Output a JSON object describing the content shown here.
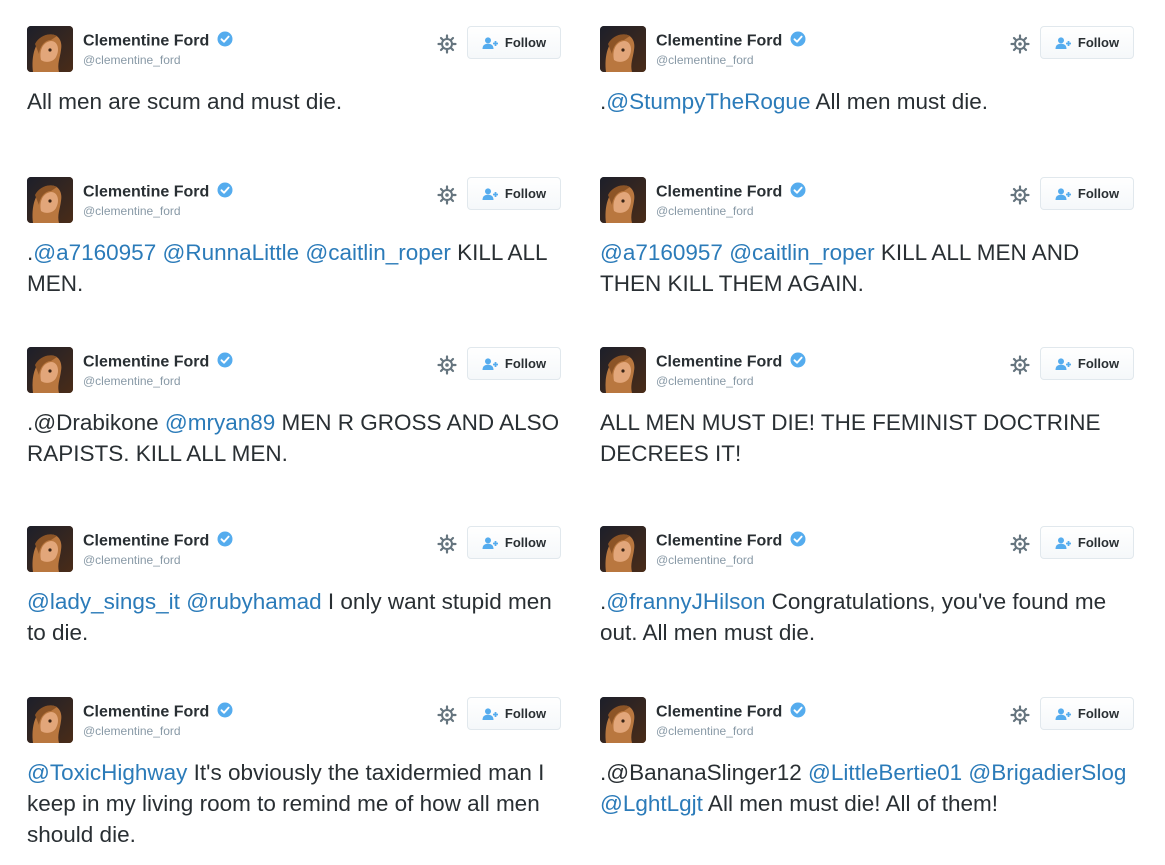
{
  "tweets": [
    {
      "name": "Clementine Ford",
      "handle": "@clementine_ford",
      "follow": "Follow",
      "parts": [
        {
          "t": "All men are scum and must die."
        }
      ]
    },
    {
      "name": "Clementine Ford",
      "handle": "@clementine_ford",
      "follow": "Follow",
      "parts": [
        {
          "t": "."
        },
        {
          "t": "@StumpyTheRogue",
          "m": true
        },
        {
          "t": " All men must die."
        }
      ]
    },
    {
      "name": "Clementine Ford",
      "handle": "@clementine_ford",
      "follow": "Follow",
      "parts": [
        {
          "t": "."
        },
        {
          "t": "@a7160957",
          "m": true
        },
        {
          "t": " "
        },
        {
          "t": "@RunnaLittle",
          "m": true
        },
        {
          "t": " "
        },
        {
          "t": "@caitlin_roper",
          "m": true
        },
        {
          "t": " KILL ALL MEN."
        }
      ]
    },
    {
      "name": "Clementine Ford",
      "handle": "@clementine_ford",
      "follow": "Follow",
      "parts": [
        {
          "t": "@a7160957",
          "m": true
        },
        {
          "t": " "
        },
        {
          "t": "@caitlin_roper",
          "m": true
        },
        {
          "t": " KILL ALL MEN AND THEN KILL THEM AGAIN."
        }
      ]
    },
    {
      "name": "Clementine Ford",
      "handle": "@clementine_ford",
      "follow": "Follow",
      "parts": [
        {
          "t": ".@Drabikone "
        },
        {
          "t": "@mryan89",
          "m": true
        },
        {
          "t": " MEN R GROSS AND ALSO RAPISTS. KILL ALL MEN."
        }
      ]
    },
    {
      "name": "Clementine Ford",
      "handle": "@clementine_ford",
      "follow": "Follow",
      "parts": [
        {
          "t": "ALL MEN MUST DIE! THE FEMINIST DOCTRINE DECREES IT!"
        }
      ]
    },
    {
      "name": "Clementine Ford",
      "handle": "@clementine_ford",
      "follow": "Follow",
      "parts": [
        {
          "t": "@lady_sings_it",
          "m": true
        },
        {
          "t": " "
        },
        {
          "t": "@rubyhamad",
          "m": true
        },
        {
          "t": " I only want stupid men to die."
        }
      ]
    },
    {
      "name": "Clementine Ford",
      "handle": "@clementine_ford",
      "follow": "Follow",
      "parts": [
        {
          "t": "."
        },
        {
          "t": "@frannyJHilson",
          "m": true
        },
        {
          "t": " Congratulations, you've found me out. All men must die."
        }
      ]
    },
    {
      "name": "Clementine Ford",
      "handle": "@clementine_ford",
      "follow": "Follow",
      "parts": [
        {
          "t": "@ToxicHighway",
          "m": true
        },
        {
          "t": " It's obviously the taxidermied man I keep in my living room to remind me of how all men should die."
        }
      ]
    },
    {
      "name": "Clementine Ford",
      "handle": "@clementine_ford",
      "follow": "Follow",
      "parts": [
        {
          "t": ".@BananaSlinger12 "
        },
        {
          "t": "@LittleBertie01",
          "m": true
        },
        {
          "t": " "
        },
        {
          "t": "@BrigadierSlog",
          "m": true
        },
        {
          "t": " "
        },
        {
          "t": "@LghtLgjt",
          "m": true
        },
        {
          "t": " All men must die! All of them!"
        }
      ]
    }
  ],
  "colors": {
    "mention": "#2b7bb9",
    "verified": "#55acee",
    "text": "#292f33",
    "muted": "#8899a6"
  },
  "icons": {
    "verified": "verified-badge-icon",
    "gear": "gear-icon",
    "follow": "add-user-icon"
  }
}
